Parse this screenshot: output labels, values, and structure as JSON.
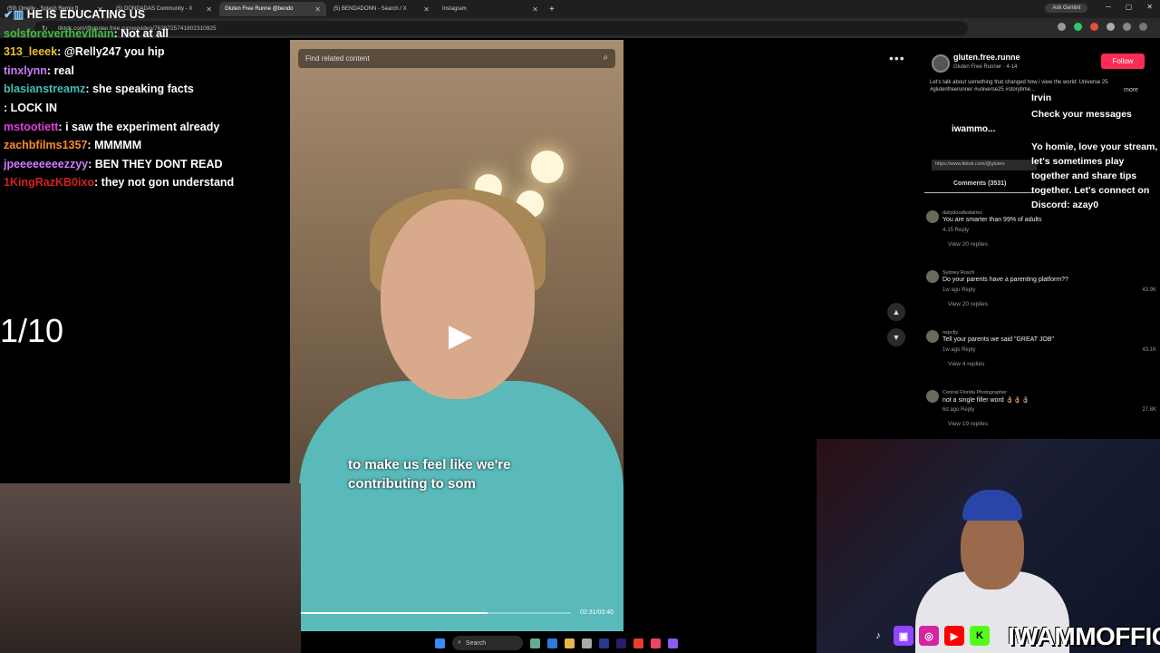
{
  "browser": {
    "tabs": [
      {
        "label": "(59) Omelly - Splash Remix ft"
      },
      {
        "label": "(5) DONDADAS Community - X"
      },
      {
        "label": "Gluten Free Runne @bendo"
      },
      {
        "label": "(5) BENDADONN - Search / X"
      },
      {
        "label": "Instagram"
      }
    ],
    "new_tab": "+",
    "ask_gemini": "Ask Gemini",
    "url": "tiktok.com/@gluten.free.runne/video/7628725741802310925"
  },
  "chat": {
    "messages": [
      {
        "user": "solsforeverthevillain",
        "user_color": "#3fbf3f",
        "text": "Not at all"
      },
      {
        "user": "313_leeek",
        "user_color": "#e8c22e",
        "text": "@Relly247 you hip"
      },
      {
        "user": "tinxlynn",
        "user_color": "#c77dff",
        "text": "real"
      },
      {
        "user": "blasianstreamz",
        "user_color": "#3fbfb6",
        "text": "she speaking facts"
      },
      {
        "user": "",
        "user_color": "#1e30d6",
        "text": "LOCK IN"
      },
      {
        "user": "mstootiett",
        "user_color": "#e03ee0",
        "text": "i saw the experiment already"
      },
      {
        "user": "zachbfilms1357",
        "user_color": "#ff8a2a",
        "text": "MMMMM"
      },
      {
        "user": "jpeeeeeeeezzyy",
        "user_color": "#d07cff",
        "text": "BEN THEY DONT READ"
      },
      {
        "user": "1KingRazKB0ixo",
        "user_color": "#d61f1f",
        "text": "they not gon understand"
      }
    ],
    "top_line": "HE IS EDUCATING US"
  },
  "ratio": "1/10",
  "video": {
    "search_placeholder": "Find related content",
    "caption": "to make us feel like we're contributing to som",
    "time": "02:31/03:40",
    "progress": 0.69
  },
  "profile": {
    "username": "gluten.free.runne",
    "subtitle": "Gluten Free Runner · 4-14",
    "follow": "Follow",
    "description": "Let's talk about something that changed how i view the world: Universe 25 #glutenfreerunner #universe25 #storytime...",
    "more": "more",
    "link": "https://www.tiktok.com/@gluten",
    "comments_tab": "Comments (3531)"
  },
  "comments": [
    {
      "user": "dailydoodledairies",
      "text": "You are smarter than 99% of adults",
      "meta": "4-15   Reply",
      "likes": "",
      "replies": "View 20 replies"
    },
    {
      "user": "Sydney Rosch",
      "text": "Do your parents have a parenting platform??",
      "meta": "1w ago   Reply",
      "likes": "43.9K",
      "replies": "View 20 replies"
    },
    {
      "user": "nspctly",
      "text": "Tell your parents we said \"GREAT JOB\"",
      "meta": "1w ago   Reply",
      "likes": "43.1K",
      "replies": "View 4 replies"
    },
    {
      "user": "Central Florida Photographer",
      "text": "not a single filler word 👌🏽👌🏽👌🏽",
      "meta": "6d ago   Reply",
      "likes": "27.8K",
      "replies": "View 19 replies"
    }
  ],
  "overlay": {
    "irvin": "Irvin",
    "check": "Check your messages",
    "iwammo": "iwammo...",
    "promo": "Yo homie, love your stream, let's sometimes play together and share tips together. Let's connect on Discord: azay0"
  },
  "streamer_handle": "IWAMMOFFICIAL",
  "taskbar": {
    "search": "Search"
  },
  "colors": {
    "follow": "#fe2c55",
    "shirt": "#5ab9b9",
    "cap": "#2746a8"
  }
}
